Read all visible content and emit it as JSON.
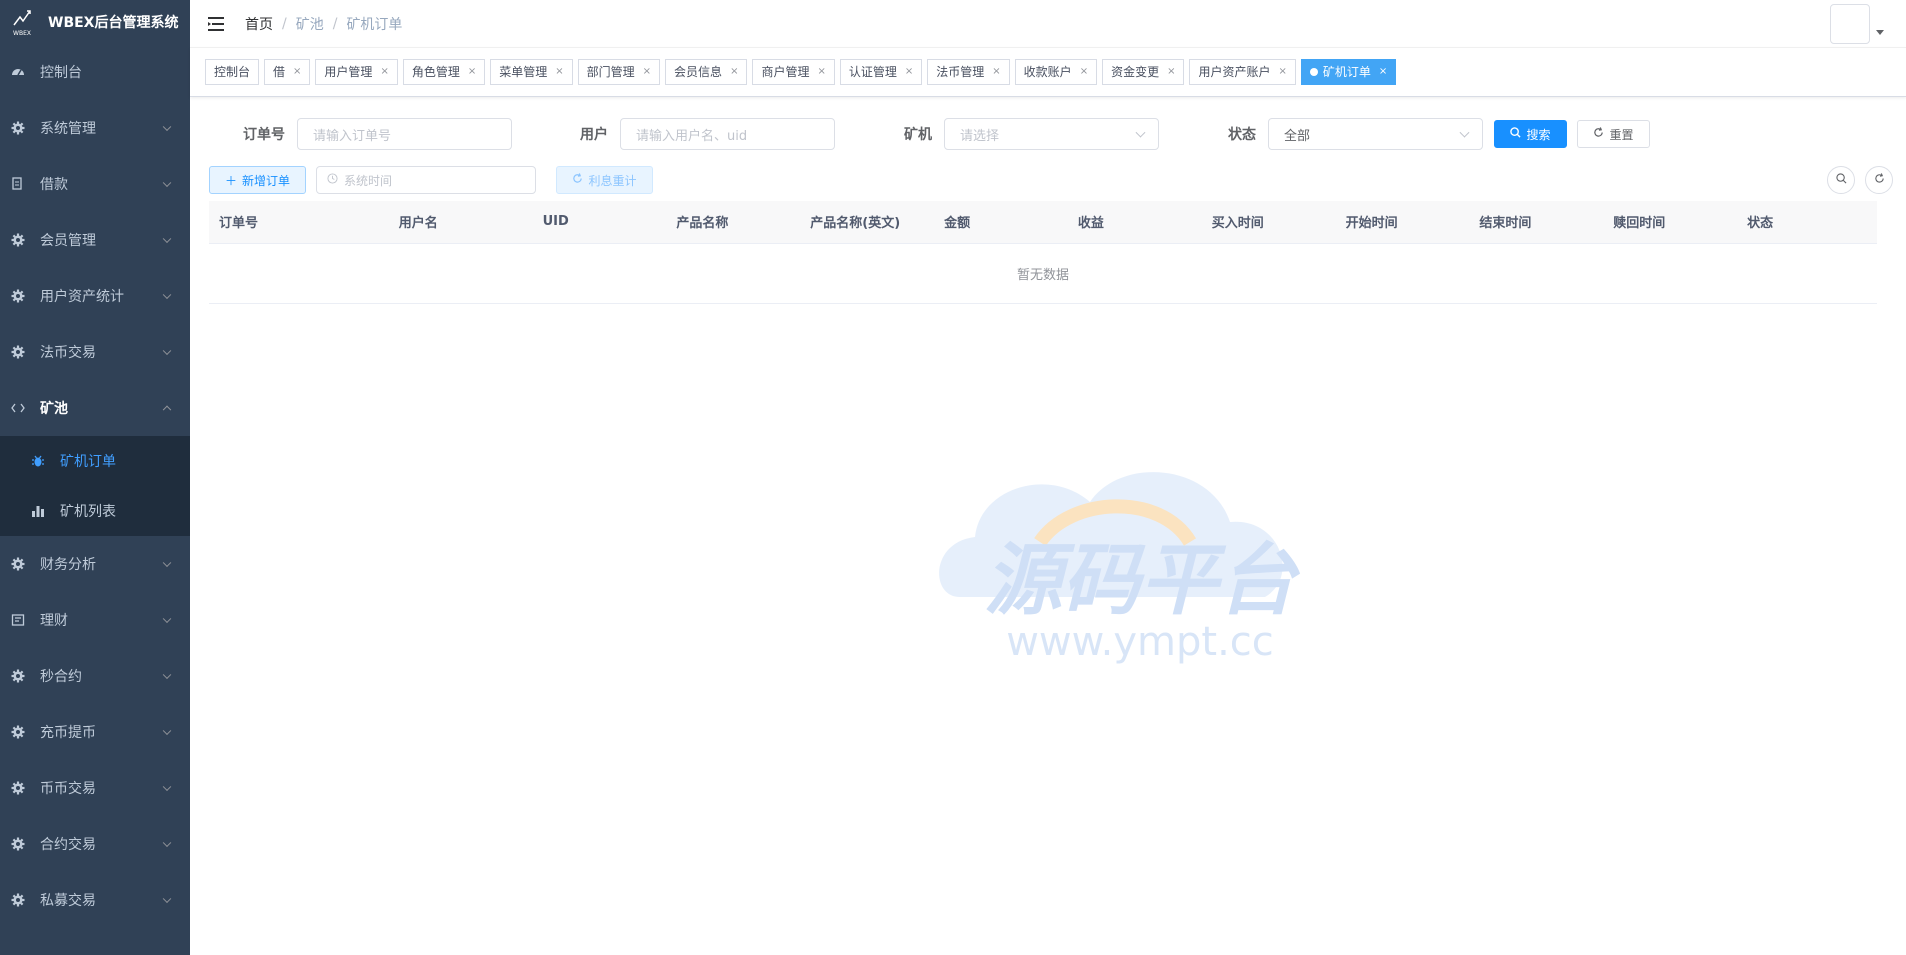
{
  "app": {
    "title": "WBEX后台管理系统",
    "logo_text": "WBEX"
  },
  "sidebar": {
    "items": [
      {
        "label": "控制台",
        "icon": "dashboard-icon",
        "has_children": false
      },
      {
        "label": "系统管理",
        "icon": "gear-icon",
        "has_children": true
      },
      {
        "label": "借款",
        "icon": "document-icon",
        "has_children": true
      },
      {
        "label": "会员管理",
        "icon": "gear-icon",
        "has_children": true
      },
      {
        "label": "用户资产统计",
        "icon": "gear-icon",
        "has_children": true
      },
      {
        "label": "法币交易",
        "icon": "gear-icon",
        "has_children": true
      },
      {
        "label": "矿池",
        "icon": "code-icon",
        "has_children": true,
        "open": true
      },
      {
        "label": "财务分析",
        "icon": "gear-icon",
        "has_children": true
      },
      {
        "label": "理财",
        "icon": "form-icon",
        "has_children": true
      },
      {
        "label": "秒合约",
        "icon": "gear-icon",
        "has_children": true
      },
      {
        "label": "充币提币",
        "icon": "gear-icon",
        "has_children": true
      },
      {
        "label": "币币交易",
        "icon": "gear-icon",
        "has_children": true
      },
      {
        "label": "合约交易",
        "icon": "gear-icon",
        "has_children": true
      },
      {
        "label": "私募交易",
        "icon": "gear-icon",
        "has_children": true
      }
    ],
    "pool_children": [
      {
        "label": "矿机订单",
        "icon": "bug-icon",
        "active": true
      },
      {
        "label": "矿机列表",
        "icon": "bar-chart-icon",
        "active": false
      }
    ]
  },
  "breadcrumb": {
    "home": "首页",
    "level1": "矿池",
    "level2": "矿机订单",
    "sep": "/"
  },
  "tags": [
    {
      "label": "控制台",
      "closable": false
    },
    {
      "label": "借",
      "closable": true
    },
    {
      "label": "用户管理",
      "closable": true
    },
    {
      "label": "角色管理",
      "closable": true
    },
    {
      "label": "菜单管理",
      "closable": true
    },
    {
      "label": "部门管理",
      "closable": true
    },
    {
      "label": "会员信息",
      "closable": true
    },
    {
      "label": "商户管理",
      "closable": true
    },
    {
      "label": "认证管理",
      "closable": true
    },
    {
      "label": "法币管理",
      "closable": true
    },
    {
      "label": "收款账户",
      "closable": true
    },
    {
      "label": "资金变更",
      "closable": true
    },
    {
      "label": "用户资产账户",
      "closable": true
    },
    {
      "label": "矿机订单",
      "closable": true,
      "active": true
    }
  ],
  "tag_close_glyph": "×",
  "filters": {
    "order_no_label": "订单号",
    "order_no_placeholder": "请输入订单号",
    "user_label": "用户",
    "user_placeholder": "请输入用户名、uid",
    "miner_label": "矿机",
    "miner_placeholder": "请选择",
    "status_label": "状态",
    "status_value": "全部",
    "search_label": "搜索",
    "reset_label": "重置"
  },
  "toolbar": {
    "add_label": "新增订单",
    "date_placeholder": "系统时间",
    "interest_label": "利息重计"
  },
  "table": {
    "columns": [
      "订单号",
      "用户名",
      "UID",
      "产品名称",
      "产品名称(英文)",
      "金额",
      "收益",
      "买入时间",
      "开始时间",
      "结束时间",
      "赎回时间",
      "状态"
    ],
    "empty_text": "暂无数据"
  },
  "watermark": {
    "title": "源码平台",
    "url": "www.ympt.cc"
  },
  "colors": {
    "sidebar_bg": "#304156",
    "submenu_bg": "#1f2d3d",
    "primary": "#1890ff",
    "active_tag": "#42a5f5"
  }
}
